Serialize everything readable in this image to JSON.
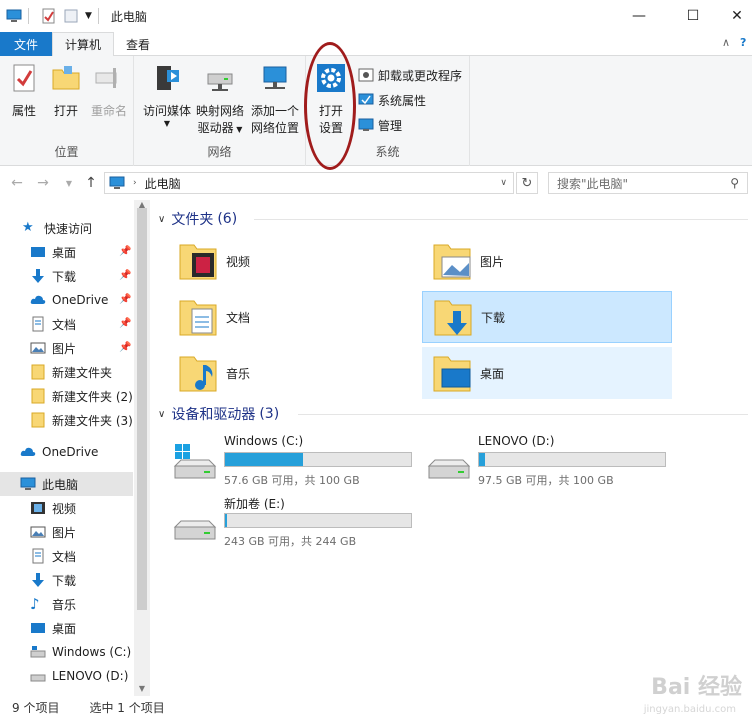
{
  "window": {
    "title": "此电脑",
    "controls": {
      "minimize": "—",
      "maximize": "☐",
      "close": "✕"
    }
  },
  "ribbon_tabs": [
    {
      "label": "文件"
    },
    {
      "label": "计算机"
    },
    {
      "label": "查看"
    }
  ],
  "ribbon": {
    "location_group": {
      "label": "位置",
      "properties": "属性",
      "open": "打开",
      "rename": "重命名"
    },
    "network_group": {
      "label": "网络",
      "access_media": "访问媒体",
      "map_drive_line1": "映射网络",
      "map_drive_line2": "驱动器",
      "add_location_line1": "添加一个",
      "add_location_line2": "网络位置"
    },
    "system_group": {
      "label": "系统",
      "open_settings_line1": "打开",
      "open_settings_line2": "设置",
      "uninstall": "卸载或更改程序",
      "system_properties": "系统属性",
      "manage": "管理"
    }
  },
  "address": {
    "path": "此电脑",
    "search_placeholder": "搜索\"此电脑\""
  },
  "nav_pane": {
    "quick_access": "快速访问",
    "quick_items": [
      "桌面",
      "下载",
      "OneDrive",
      "文档",
      "图片",
      "新建文件夹",
      "新建文件夹 (2)",
      "新建文件夹 (3)"
    ],
    "onedrive": "OneDrive",
    "this_pc": "此电脑",
    "pc_items": [
      "视频",
      "图片",
      "文档",
      "下载",
      "音乐",
      "桌面",
      "Windows (C:)",
      "LENOVO (D:)"
    ]
  },
  "content": {
    "folders_title": "文件夹",
    "folders_count": "(6)",
    "folders": [
      "视频",
      "图片",
      "文档",
      "下载",
      "音乐",
      "桌面"
    ],
    "drives_title": "设备和驱动器",
    "drives_count": "(3)",
    "drives": [
      {
        "name": "Windows (C:)",
        "info": "57.6 GB 可用，共 100 GB",
        "used_fraction": 0.42
      },
      {
        "name": "LENOVO (D:)",
        "info": "97.5 GB 可用，共 100 GB",
        "used_fraction": 0.03
      },
      {
        "name": "新加卷 (E:)",
        "info": "243 GB 可用，共 244 GB",
        "used_fraction": 0.01
      }
    ]
  },
  "status": {
    "item_count": "9 个项目",
    "selected": "选中 1 个项目"
  },
  "watermark": {
    "main": "Bai 经验",
    "sub": "jingyan.baidu.com"
  },
  "colors": {
    "accent": "#1979ca",
    "drive_fill": "#26a0da",
    "folder": "#f8d775",
    "highlight": "#a01c1c"
  }
}
